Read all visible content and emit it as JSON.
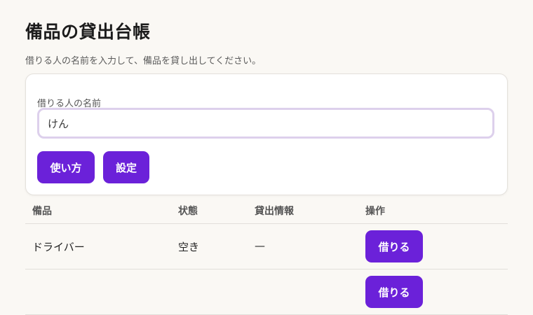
{
  "header": {
    "title": "備品の貸出台帳",
    "subtitle": "借りる人の名前を入力して、備品を貸し出してください。"
  },
  "form": {
    "name_label": "借りる人の名前",
    "name_value": "けん",
    "usage_button": "使い方",
    "settings_button": "設定"
  },
  "table": {
    "columns": [
      "備品",
      "状態",
      "貸出情報",
      "操作"
    ],
    "rows": [
      {
        "item": "ドライバー",
        "status": "空き",
        "info": "—",
        "action": "借りる"
      },
      {
        "item": "",
        "status": "",
        "info": "",
        "action": "借りる"
      }
    ]
  },
  "colors": {
    "accent": "#6b21d9",
    "input_border": "#ddd0ec",
    "background": "#faf8f4"
  }
}
